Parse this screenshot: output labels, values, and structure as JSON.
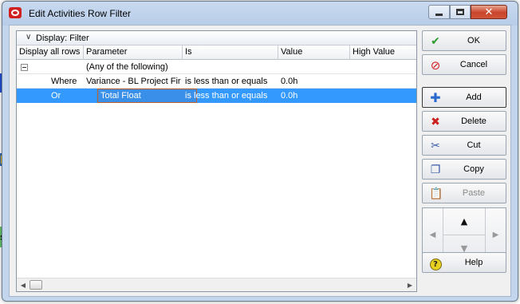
{
  "window": {
    "title": "Edit Activities Row Filter",
    "controls": {
      "close": "✕"
    }
  },
  "grid": {
    "group_label": "Display: Filter",
    "columns": [
      "Display all rows",
      "Parameter",
      "Is",
      "Value",
      "High Value"
    ],
    "rows": [
      {
        "display": "",
        "parameter": "(Any of the following)",
        "is": "",
        "value": "",
        "high": ""
      },
      {
        "display": "Where",
        "parameter": "Variance - BL Project Fir",
        "is": "is less than or equals",
        "value": "0.0h",
        "high": ""
      },
      {
        "display": "Or",
        "parameter": "Total Float",
        "is": "is less than or equals",
        "value": "0.0h",
        "high": ""
      }
    ],
    "selected_row": 2
  },
  "buttons": {
    "ok": "OK",
    "cancel": "Cancel",
    "add": "Add",
    "delete": "Delete",
    "cut": "Cut",
    "copy": "Copy",
    "paste": "Paste",
    "help": "Help"
  },
  "colors": {
    "selection": "#3399ff",
    "ok_icon": "#2e9a2e",
    "cancel_icon": "#d42222",
    "delete_icon": "#cc2020",
    "help_icon": "#e8d020"
  }
}
